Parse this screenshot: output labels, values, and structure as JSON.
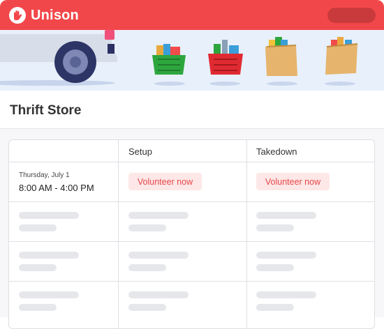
{
  "header": {
    "brand": "Unison",
    "logo_icon": "hand-heart-icon",
    "accent_color": "#f2474a"
  },
  "banner": {
    "illustration": "delivery-van-and-grocery-baskets",
    "items": [
      "green-basket-icon",
      "red-basket-icon",
      "paper-bag-icon",
      "paper-bag-icon"
    ]
  },
  "page": {
    "title": "Thrift Store"
  },
  "table": {
    "columns": [
      "",
      "Setup",
      "Takedown"
    ],
    "first_row": {
      "date": "Thursday, July 1",
      "time": "8:00 AM - 4:00 PM",
      "setup_action": "Volunteer now",
      "takedown_action": "Volunteer now"
    },
    "placeholder_rows": 3
  }
}
